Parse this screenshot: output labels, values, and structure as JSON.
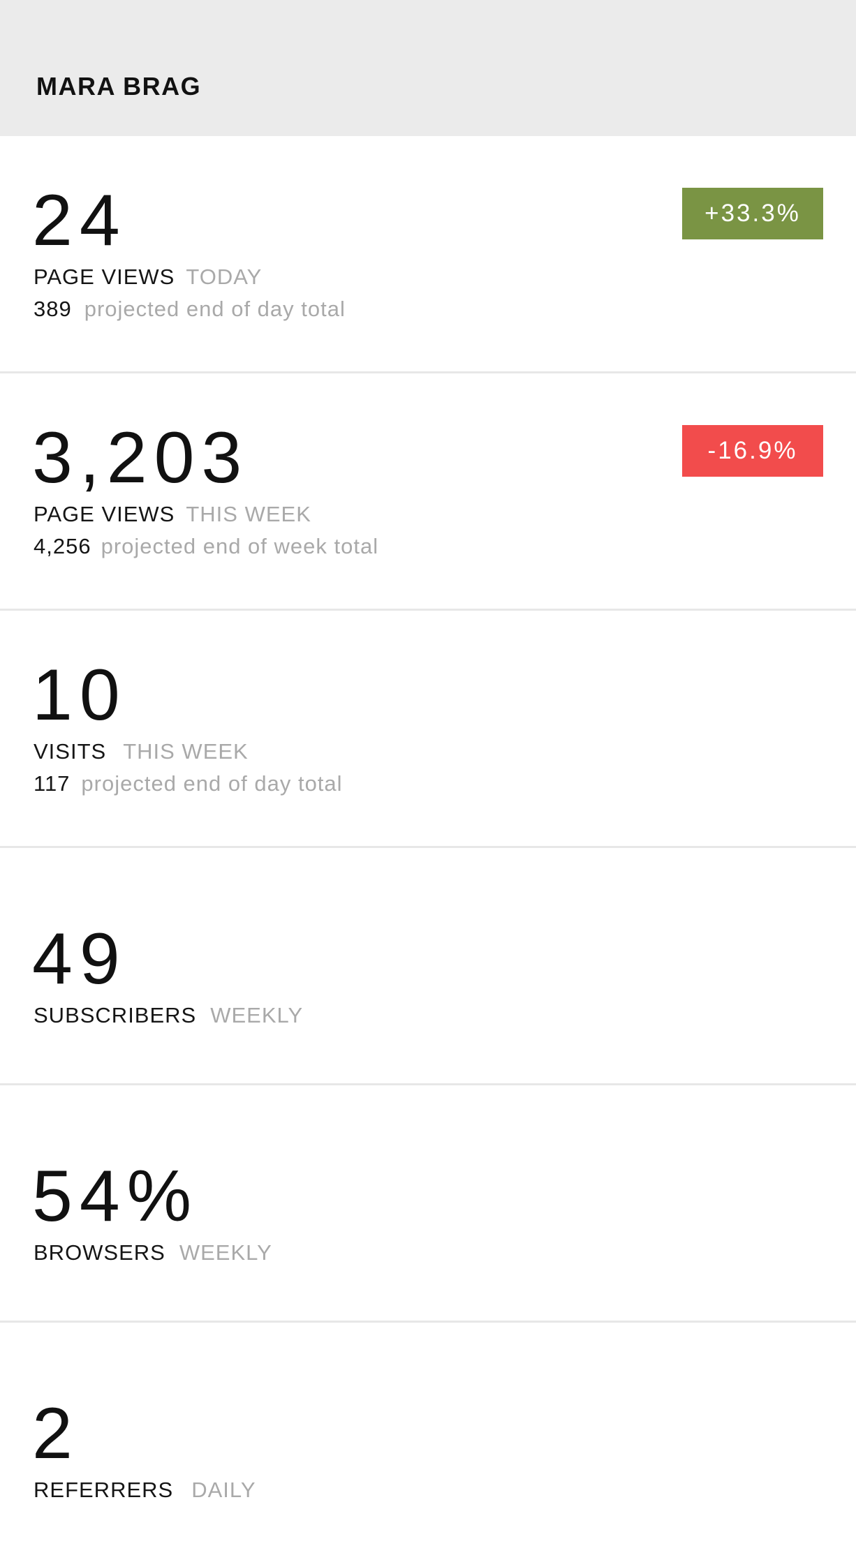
{
  "header": {
    "site_title": "MARA BRAG"
  },
  "metrics": [
    {
      "value": "24",
      "label": "PAGE VIEWS",
      "period": "TODAY",
      "projection_value": "389",
      "projection_text": "projected end of day total",
      "change": "+33.3%",
      "change_color": "#7a9444"
    },
    {
      "value": "3,203",
      "label": "PAGE VIEWS",
      "period": "THIS WEEK",
      "projection_value": "4,256",
      "projection_text": "projected end of week total",
      "change": "-16.9%",
      "change_color": "#f24c4c"
    },
    {
      "value": "10",
      "label": "VISITS",
      "period": "THIS WEEK",
      "projection_value": "117",
      "projection_text": "projected end of day total"
    },
    {
      "value": "49",
      "label": "SUBSCRIBERS",
      "period": "WEEKLY"
    },
    {
      "value": "54%",
      "label": "BROWSERS",
      "period": "WEEKLY"
    },
    {
      "value": "2",
      "label": "REFERRERS",
      "period": "DAILY"
    }
  ]
}
